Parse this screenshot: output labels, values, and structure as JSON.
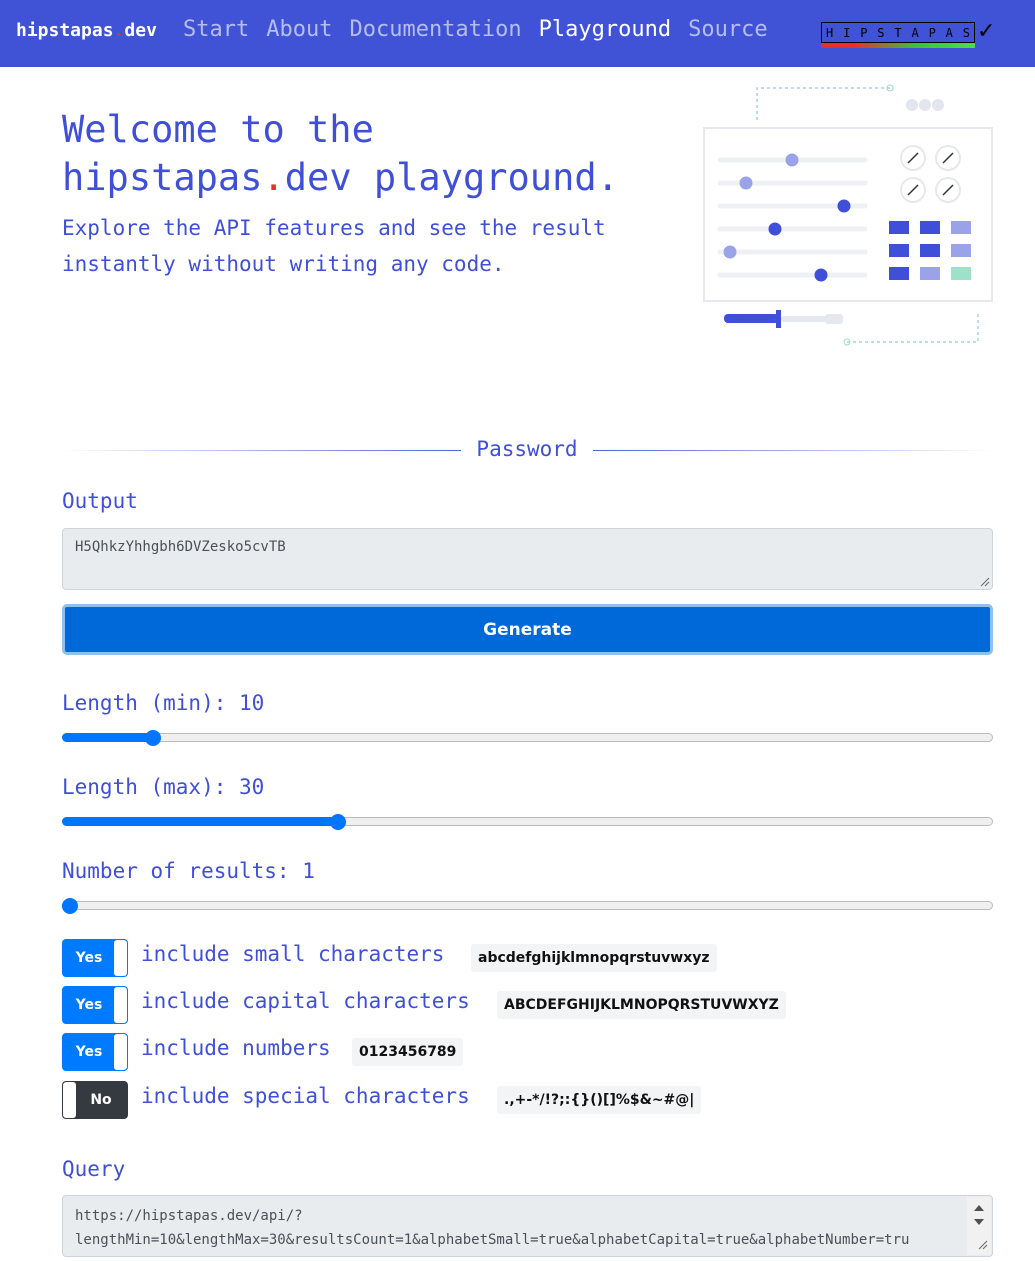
{
  "nav": {
    "brand_main": "hipstapas",
    "brand_dot": ".",
    "brand_tld": "dev",
    "links": [
      "Start",
      "About",
      "Documentation",
      "Playground",
      "Source"
    ],
    "active": "Playground",
    "logo_text": "HIPSTAPAS",
    "logo_check": "✓"
  },
  "hero": {
    "title_line1": "Welcome to the",
    "title_brand": "hipstapas",
    "title_dot": ".",
    "title_rest": "dev playground.",
    "subtitle": "Explore the API features and see the result instantly without writing any code."
  },
  "section": {
    "title": "Password"
  },
  "output": {
    "label": "Output",
    "value": "H5QhkzYhhgbh6DVZesko5cvTB"
  },
  "generate_label": "Generate",
  "sliders": [
    {
      "label": "Length (min): 10",
      "value": 10,
      "min": 1,
      "max": 100
    },
    {
      "label": "Length (max): 30",
      "value": 30,
      "min": 1,
      "max": 100
    },
    {
      "label": "Number of results: 1",
      "value": 1,
      "min": 1,
      "max": 100
    }
  ],
  "toggles": [
    {
      "state": "Yes",
      "on": true,
      "text": "include small characters",
      "chars": "abcdefghijklmnopqrstuvwxyz"
    },
    {
      "state": "Yes",
      "on": true,
      "text": "include capital characters",
      "chars": "ABCDEFGHIJKLMNOPQRSTUVWXYZ"
    },
    {
      "state": "Yes",
      "on": true,
      "text": "include numbers",
      "chars": "0123456789"
    },
    {
      "state": "No",
      "on": false,
      "text": "include special characters",
      "chars": ".,+-*/!?;:{}()[]%$&~#@|"
    }
  ],
  "query": {
    "label": "Query",
    "line1": "https://hipstapas.dev/api/?",
    "line2": "lengthMin=10&lengthMax=30&resultsCount=1&alphabetSmall=true&alphabetCapital=true&alphabetNumber=tru"
  },
  "colors": {
    "nav_bg": "#4052d6",
    "accent": "#3f4fd8",
    "primary": "#0069d9",
    "toggle_on": "#007bff",
    "toggle_off": "#343a40"
  }
}
